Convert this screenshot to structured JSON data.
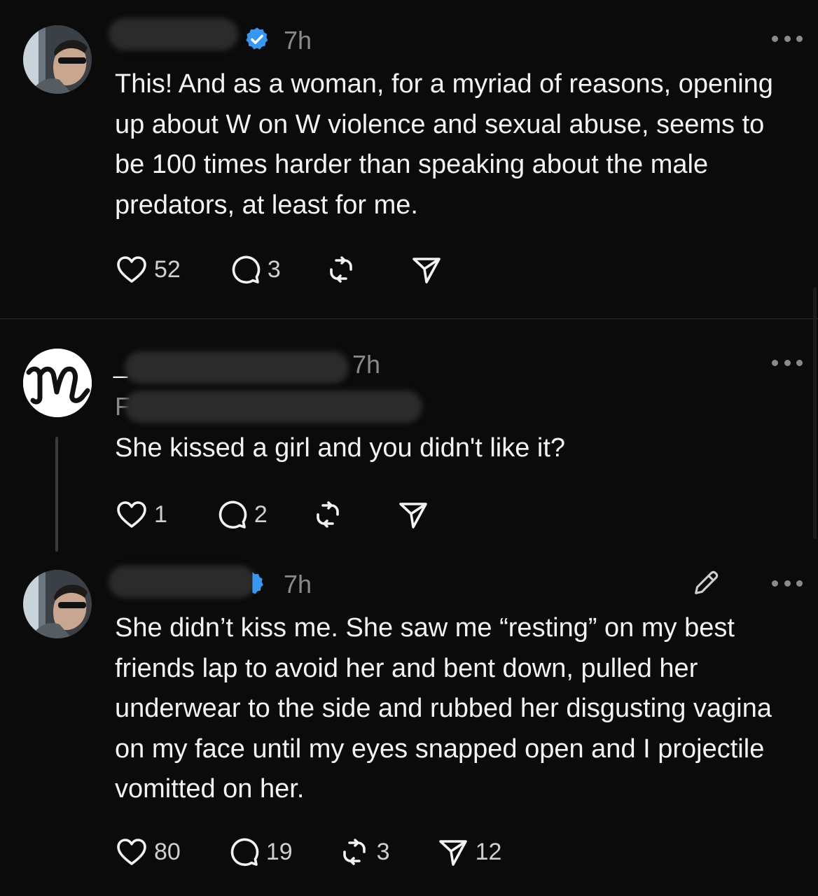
{
  "posts": [
    {
      "time": "7h",
      "text": "This! And as a woman, for a myriad of reasons, opening up about W on W violence and sexual abuse, seems to be 100 times harder than speaking about the male predators, at least for me.",
      "likes": "52",
      "replies": "3",
      "reposts": "",
      "shares": ""
    },
    {
      "time": "7h",
      "name_fragment": "_",
      "sub_fragment": "F",
      "text": "She kissed a girl and you didn't like it?",
      "likes": "1",
      "replies": "2",
      "reposts": "",
      "shares": ""
    },
    {
      "time": "7h",
      "text": "She didn’t kiss me. She saw me “resting” on my best friends lap to avoid her and bent down, pulled her underwear to the side and rubbed her disgusting vagina on my face until my eyes snapped open and I projectile vomitted on her.",
      "likes": "80",
      "replies": "19",
      "reposts": "3",
      "shares": "12"
    }
  ],
  "colors": {
    "background": "#0b0b0b",
    "text": "#f3f3f3",
    "muted": "#8a8a8a",
    "verified": "#3897f0"
  },
  "icons": [
    "heart-icon",
    "comment-icon",
    "repost-icon",
    "share-icon",
    "more-icon",
    "verified-badge-icon",
    "edit-icon"
  ]
}
